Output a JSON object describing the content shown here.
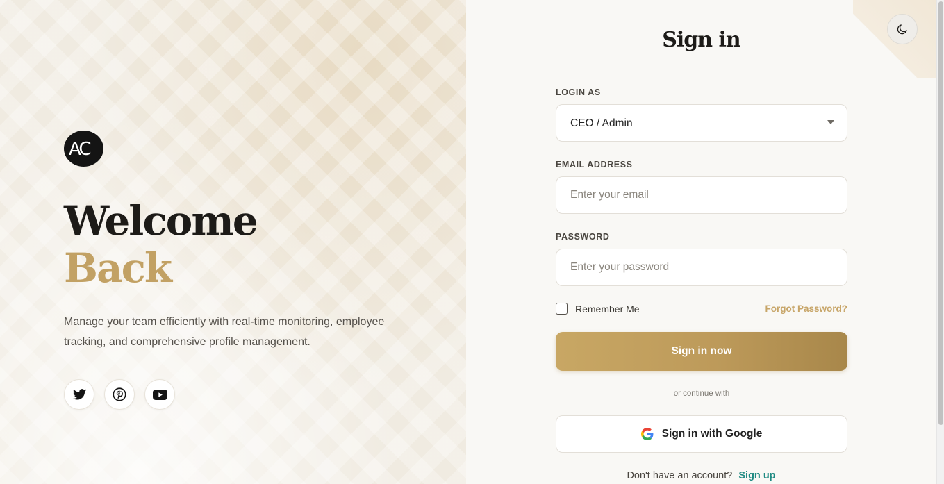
{
  "hero": {
    "logo_text": "AC",
    "title_line1": "Welcome",
    "title_line2": "Back",
    "description": "Manage your team efficiently with real-time monitoring, employee tracking, and comprehensive profile management.",
    "socials": [
      {
        "icon": "twitter-icon"
      },
      {
        "icon": "pinterest-icon"
      },
      {
        "icon": "youtube-icon"
      }
    ]
  },
  "form": {
    "title": "Sign in",
    "login_as_label": "LOGIN AS",
    "login_as_value": "CEO / Admin",
    "email_label": "EMAIL ADDRESS",
    "email_placeholder": "Enter your email",
    "password_label": "PASSWORD",
    "password_placeholder": "Enter your password",
    "remember_label": "Remember Me",
    "remember_checked": false,
    "forgot_label": "Forgot Password?",
    "submit_label": "Sign in now",
    "divider_text": "or continue with",
    "google_label": "Sign in with Google",
    "no_account_text": "Don't have an account?",
    "signup_label": "Sign up"
  },
  "theme_toggle": {
    "icon": "moon-icon"
  },
  "colors": {
    "accent_gold": "#c2a164",
    "link_teal": "#1f8a82",
    "text_dark": "#1d1b18"
  }
}
